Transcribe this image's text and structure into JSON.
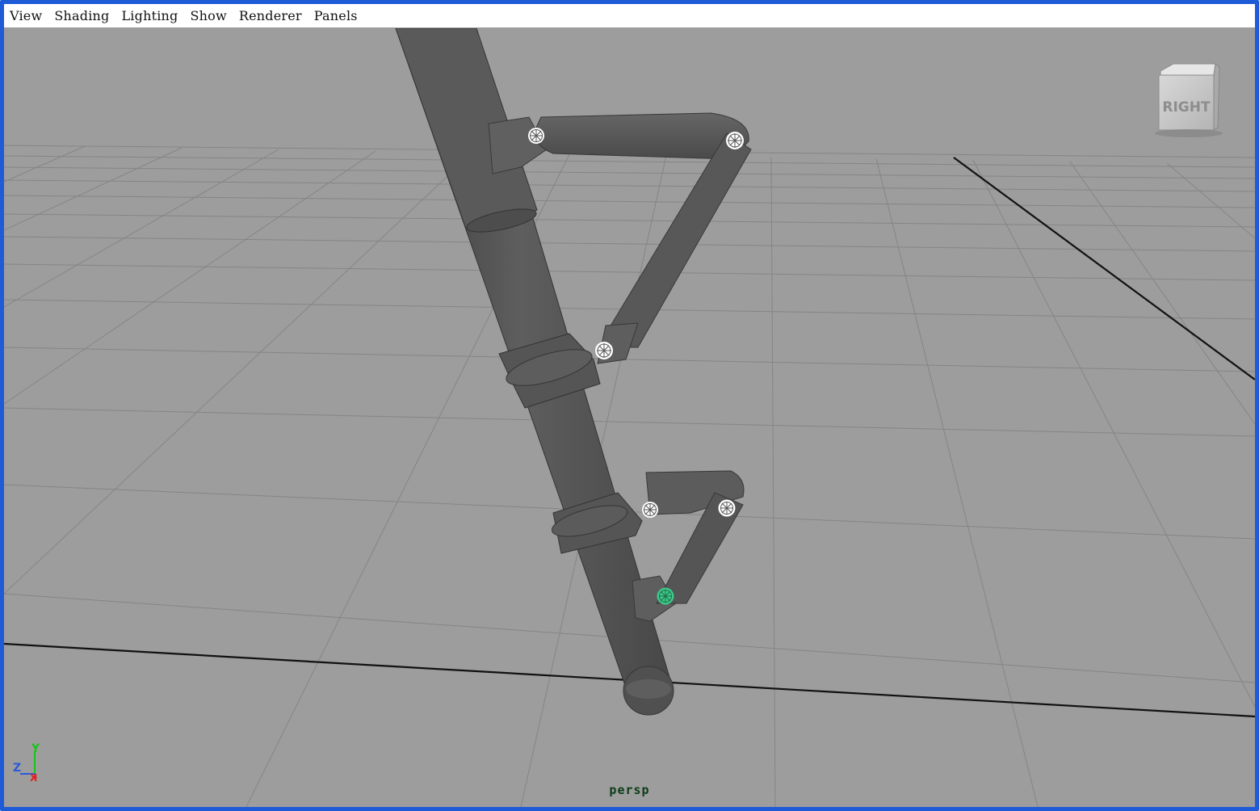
{
  "menubar": {
    "items": [
      {
        "label": "View"
      },
      {
        "label": "Shading"
      },
      {
        "label": "Lighting"
      },
      {
        "label": "Show"
      },
      {
        "label": "Renderer"
      },
      {
        "label": "Panels"
      }
    ]
  },
  "viewport": {
    "camera_name": "persp",
    "view_cube_label": "RIGHT",
    "axis_labels": {
      "x": "X",
      "y": "Y",
      "z": "Z"
    },
    "background_color": "#9d9d9d",
    "mesh_color": "#555555",
    "selected_joint_color": "#3ec98a"
  }
}
